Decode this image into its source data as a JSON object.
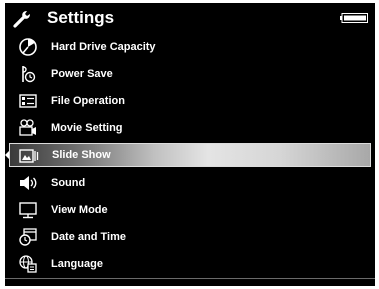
{
  "header": {
    "title": "Settings",
    "icon": "wrench-icon",
    "battery_icon": "battery-icon"
  },
  "menu": {
    "items": [
      {
        "label": "Hard Drive Capacity",
        "icon": "pie-chart-icon"
      },
      {
        "label": "Power Save",
        "icon": "power-save-icon"
      },
      {
        "label": "File Operation",
        "icon": "file-operation-icon"
      },
      {
        "label": "Movie Setting",
        "icon": "movie-camera-icon"
      },
      {
        "label": "Slide Show",
        "icon": "slideshow-icon",
        "selected": true
      },
      {
        "label": "Sound",
        "icon": "speaker-icon"
      },
      {
        "label": "View Mode",
        "icon": "monitor-icon"
      },
      {
        "label": "Date and Time",
        "icon": "clock-calendar-icon"
      },
      {
        "label": "Language",
        "icon": "language-icon"
      }
    ]
  },
  "colors": {
    "background": "#000000",
    "text": "#ffffff",
    "selection_highlight": "#d6d6d6"
  }
}
